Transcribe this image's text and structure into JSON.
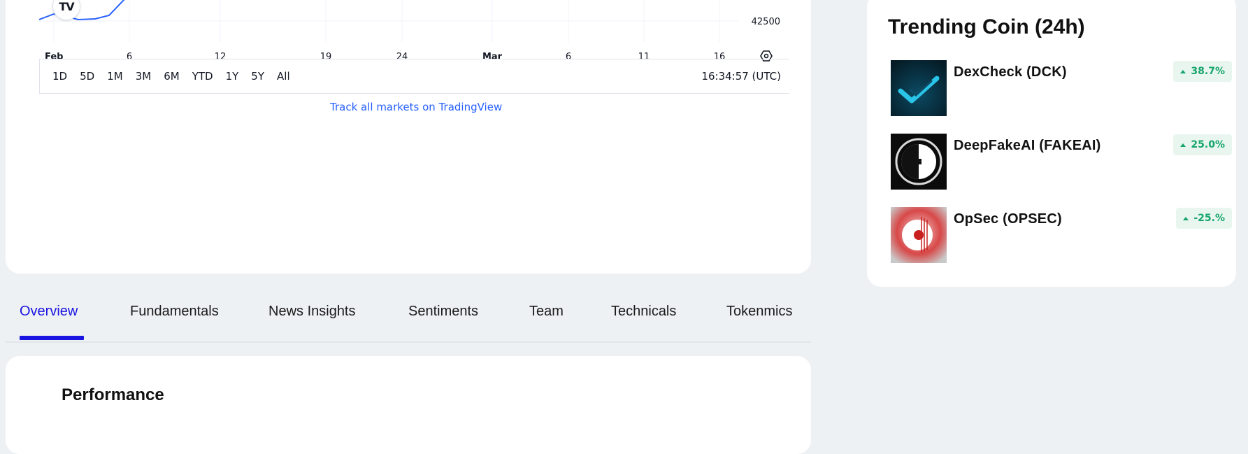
{
  "chart": {
    "x_ticks": [
      {
        "label": "Feb",
        "bold": true
      },
      {
        "label": "6",
        "bold": false
      },
      {
        "label": "12",
        "bold": false
      },
      {
        "label": "19",
        "bold": false
      },
      {
        "label": "24",
        "bold": false
      },
      {
        "label": "Mar",
        "bold": true
      },
      {
        "label": "6",
        "bold": false
      },
      {
        "label": "11",
        "bold": false
      },
      {
        "label": "16",
        "bold": false
      }
    ],
    "price_label": "42500",
    "logo_text": "TV",
    "settings_icon": "settings-hexagon-icon",
    "line_color": "#2962ff"
  },
  "toolbar": {
    "ranges": [
      "1D",
      "5D",
      "1M",
      "3M",
      "6M",
      "YTD",
      "1Y",
      "5Y",
      "All"
    ],
    "clock": "16:34:57 (UTC)"
  },
  "tv_link": "Track all markets on TradingView",
  "tabs": {
    "items": [
      "Overview",
      "Fundamentals",
      "News Insights",
      "Sentiments",
      "Team",
      "Technicals",
      "Tokenmics"
    ],
    "active": "Overview",
    "active_color": "#1a14e0"
  },
  "performance": {
    "title": "Performance"
  },
  "trending": {
    "title": "Trending Coin (24h)",
    "coins": [
      {
        "name": "DexCheck  (DCK)",
        "change": "38.7%",
        "icon": "dexcheck-logo"
      },
      {
        "name": "DeepFakeAI  (FAKEAI)",
        "change": "25.0%",
        "icon": "deepfakeai-logo"
      },
      {
        "name": "OpSec  (OPSEC)",
        "change": "-25.%",
        "icon": "opsec-logo"
      }
    ],
    "badge_color": "#16a56b"
  }
}
